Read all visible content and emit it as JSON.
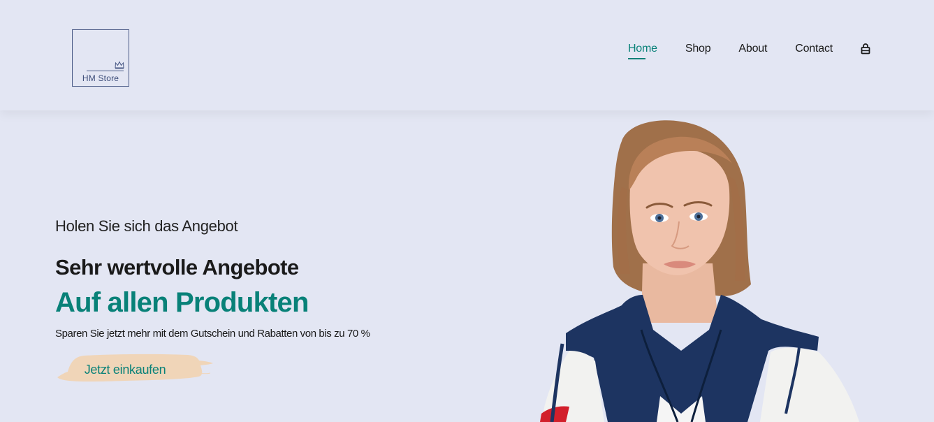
{
  "header": {
    "logo": {
      "text": "HM Store",
      "icon": "crown-icon",
      "color": "#4a5a86"
    },
    "nav": {
      "items": [
        {
          "label": "Home",
          "active": true
        },
        {
          "label": "Shop",
          "active": false
        },
        {
          "label": "About",
          "active": false
        },
        {
          "label": "Contact",
          "active": false
        }
      ],
      "cart_icon": "shopping-bag-icon"
    }
  },
  "hero": {
    "kicker": "Holen Sie sich das Angebot",
    "heading": "Sehr wertvolle Angebote",
    "highlight": "Auf allen Produkten",
    "description": "Sparen Sie jetzt mehr mit dem Gutschein und Rabatten von bis zu 70 %",
    "cta_label": "Jetzt einkaufen",
    "image": "model-in-windbreaker-photo"
  },
  "colors": {
    "background": "#e3e6f3",
    "accent": "#088178",
    "text": "#1a1a1a",
    "button_brush": "#f0d5b8"
  }
}
